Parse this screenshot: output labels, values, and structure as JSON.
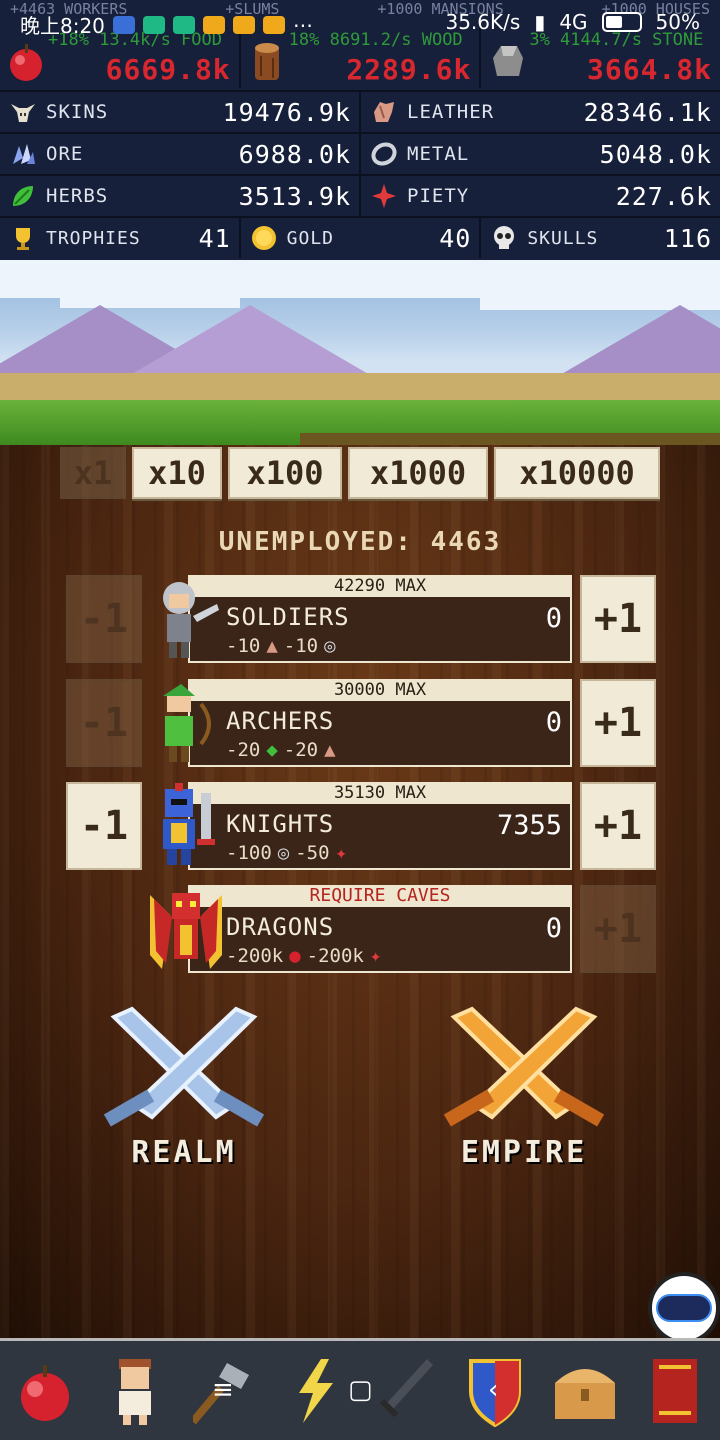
{
  "status_bar": {
    "time": "晚上8:20",
    "network_speed": "35.6K/s",
    "signal": "4G",
    "battery": "50%"
  },
  "ghost_row": [
    "+4463 WORKERS",
    "+SLUMS",
    "+1000 MANSIONS",
    "+1000 HOUSES"
  ],
  "top_resources": [
    {
      "name": "food",
      "icon": "apple-icon",
      "rate": "+18% 13.4k/s FOOD",
      "amount": "6669.8k"
    },
    {
      "name": "wood",
      "icon": "log-icon",
      "rate": "18% 8691.2/s WOOD",
      "amount": "2289.6k"
    },
    {
      "name": "stone",
      "icon": "stone-icon",
      "rate": "3% 4144.7/s STONE",
      "amount": "3664.8k"
    }
  ],
  "resources": [
    [
      {
        "label": "SKINS",
        "icon": "skull-horns-icon",
        "value": "19476.9k"
      },
      {
        "label": "LEATHER",
        "icon": "leather-icon",
        "value": "28346.1k"
      }
    ],
    [
      {
        "label": "ORE",
        "icon": "ore-icon",
        "value": "6988.0k"
      },
      {
        "label": "METAL",
        "icon": "metal-ring-icon",
        "value": "5048.0k"
      }
    ],
    [
      {
        "label": "HERBS",
        "icon": "herb-leaf-icon",
        "value": "3513.9k"
      },
      {
        "label": "PIETY",
        "icon": "piety-cross-icon",
        "value": "227.6k"
      }
    ],
    [
      {
        "label": "TROPHIES",
        "icon": "trophy-icon",
        "value": "41"
      },
      {
        "label": "GOLD",
        "icon": "gold-coin-icon",
        "value": "40"
      },
      {
        "label": "SKULLS",
        "icon": "skull-icon",
        "value": "116"
      }
    ]
  ],
  "multipliers": [
    "x1",
    "x10",
    "x100",
    "x1000",
    "x10000"
  ],
  "unemployed": {
    "label": "UNEMPLOYED:",
    "value": "4463"
  },
  "units": [
    {
      "name": "SOLDIERS",
      "cap": "42290 MAX",
      "count": "0",
      "minus": "-1",
      "plus": "+1",
      "cost1": "-10",
      "cost1_icon": "leather",
      "cost2": "-10",
      "cost2_icon": "metal",
      "minus_enabled": false,
      "plus_enabled": true,
      "cap_required": false
    },
    {
      "name": "ARCHERS",
      "cap": "30000 MAX",
      "count": "0",
      "minus": "-1",
      "plus": "+1",
      "cost1": "-20",
      "cost1_icon": "herbs",
      "cost2": "-20",
      "cost2_icon": "leather",
      "minus_enabled": false,
      "plus_enabled": true,
      "cap_required": false
    },
    {
      "name": "KNIGHTS",
      "cap": "35130 MAX",
      "count": "7355",
      "minus": "-1",
      "plus": "+1",
      "cost1": "-100",
      "cost1_icon": "metal",
      "cost2": "-50",
      "cost2_icon": "piety",
      "minus_enabled": true,
      "plus_enabled": true,
      "cap_required": false
    },
    {
      "name": "DRAGONS",
      "cap": "REQUIRE CAVES",
      "count": "0",
      "minus": "",
      "plus": "+1",
      "cost1": "-200k",
      "cost1_icon": "food",
      "cost2": "-200k",
      "cost2_icon": "piety",
      "minus_enabled": false,
      "plus_enabled": false,
      "cap_required": true
    }
  ],
  "actions": {
    "realm": "REALM",
    "empire": "EMPIRE"
  },
  "toolbar": [
    "food-tab",
    "people-tab",
    "build-tab",
    "magic-tab",
    "military-tab",
    "defense-tab",
    "treasure-tab",
    "book-tab"
  ],
  "colors": {
    "rate_green": "#2f9a3a",
    "amount_red": "#d9272f",
    "header_bg": "#17203a",
    "require_red": "#b5241f"
  }
}
